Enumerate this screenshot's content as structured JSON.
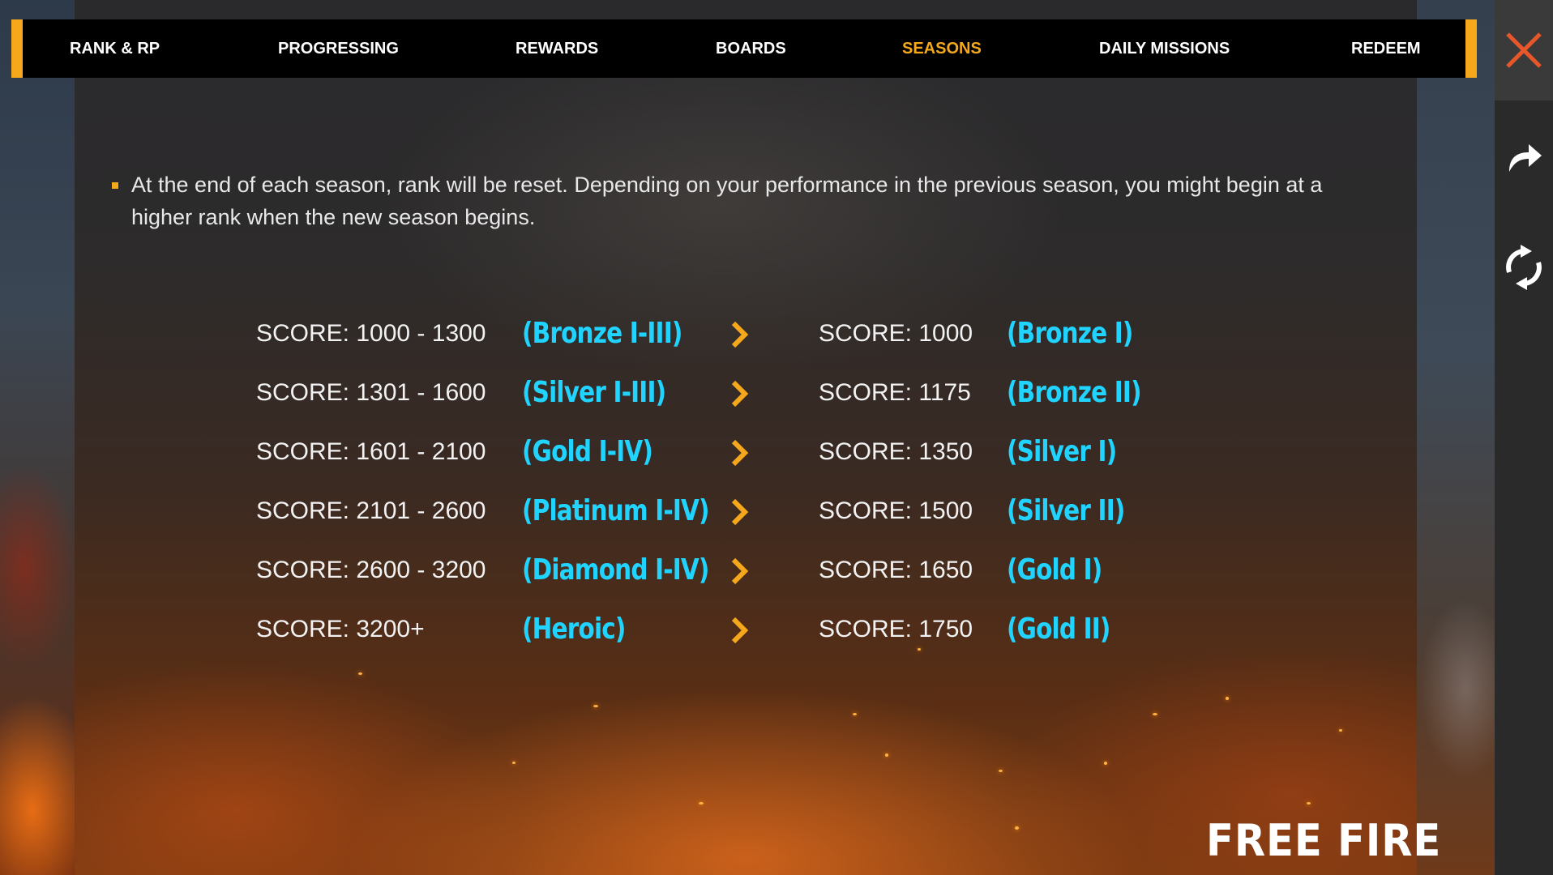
{
  "nav": {
    "tabs": [
      {
        "label": "RANK & RP"
      },
      {
        "label": "PROGRESSING"
      },
      {
        "label": "REWARDS"
      },
      {
        "label": "BOARDS"
      },
      {
        "label": "SEASONS",
        "active": true
      },
      {
        "label": "DAILY MISSIONS"
      },
      {
        "label": "REDEEM"
      }
    ]
  },
  "sidebar": {
    "close_icon": "close-icon",
    "share_icon": "share-arrow-icon",
    "refresh_icon": "refresh-icon"
  },
  "seasons": {
    "intro": "At the end of each season, rank will be reset. Depending on your performance in the previous season, you might begin at a higher rank when the new season begins.",
    "rows": [
      {
        "from_score": "SCORE: 1000 - 1300",
        "from_rank": "(Bronze I-III)",
        "to_score": "SCORE: 1000",
        "to_rank": "(Bronze I)"
      },
      {
        "from_score": "SCORE: 1301 - 1600",
        "from_rank": "(Silver I-III)",
        "to_score": "SCORE: 1175",
        "to_rank": "(Bronze II)"
      },
      {
        "from_score": "SCORE: 1601 - 2100",
        "from_rank": "(Gold I-IV)",
        "to_score": "SCORE: 1350",
        "to_rank": "(Silver I)"
      },
      {
        "from_score": "SCORE: 2101 - 2600",
        "from_rank": "(Platinum I-IV)",
        "to_score": "SCORE: 1500",
        "to_rank": "(Silver II)"
      },
      {
        "from_score": "SCORE: 2600 - 3200",
        "from_rank": "(Diamond I-IV)",
        "to_score": "SCORE: 1650",
        "to_rank": "(Gold I)"
      },
      {
        "from_score": "SCORE: 3200+",
        "from_rank": "(Heroic)",
        "to_score": "SCORE: 1750",
        "to_rank": "(Gold II)"
      }
    ]
  },
  "logo": {
    "text": "FREE FIRE"
  },
  "colors": {
    "accent": "#f5a81c",
    "rank_text": "#20d4ff",
    "close": "#e8572a"
  }
}
